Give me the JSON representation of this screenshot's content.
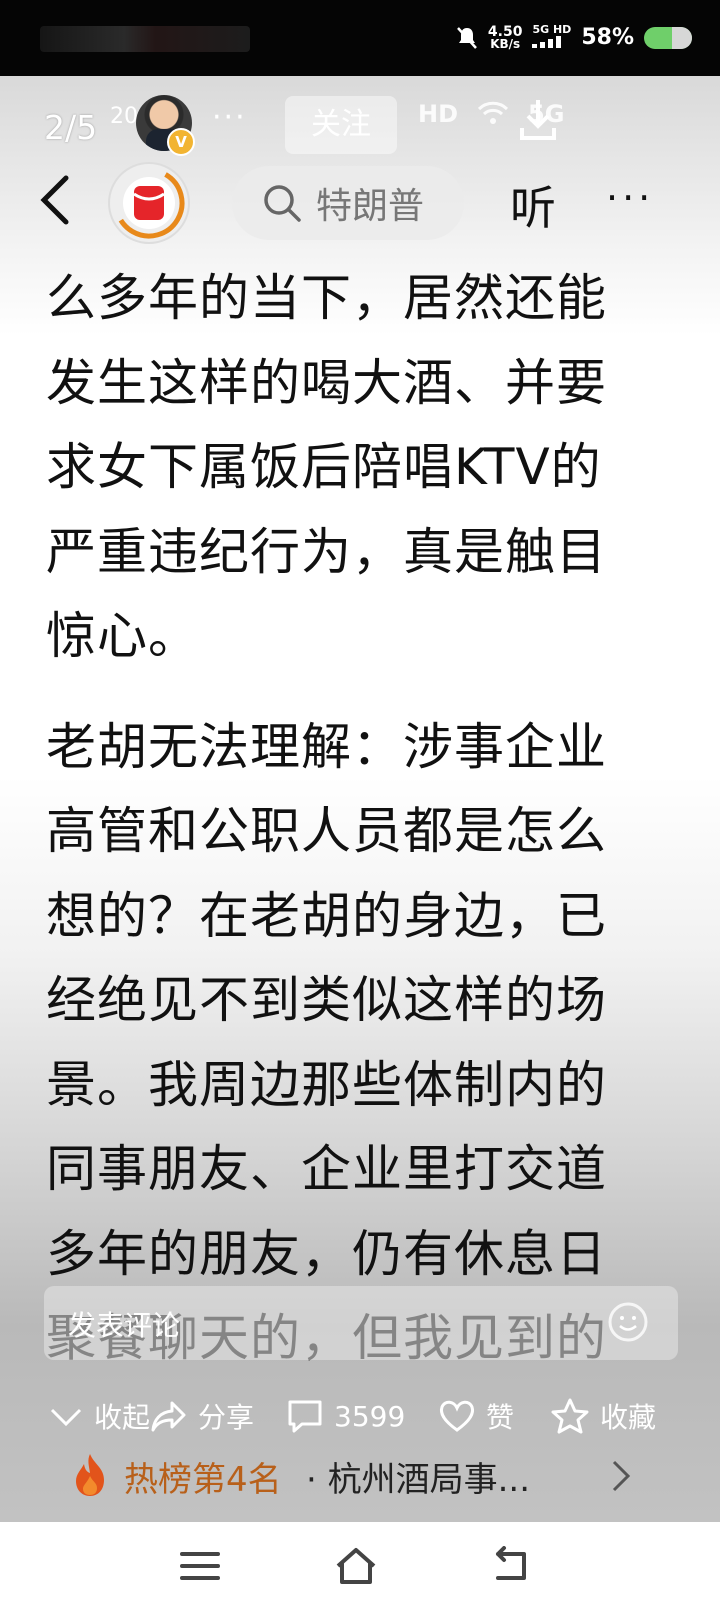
{
  "status_bar": {
    "speed_value": "4.50",
    "speed_unit": "KB/s",
    "network": "5G HD",
    "battery_percent": "58%",
    "battery_level": 0.58
  },
  "top_strip": {
    "page_counter": "2/5",
    "page_counter_sup": "20",
    "author_badge": "V",
    "more": "···",
    "follow_label": "关注",
    "hd_label": "HD",
    "sig_label": "5G"
  },
  "nav": {
    "search_text": "特朗普",
    "listen_label": "听",
    "more": "···"
  },
  "article": {
    "paragraphs": [
      "么多年的当下，居然还能发生这样的喝大酒、并要求女下属饭后陪唱KTV的严重违纪行为，真是触目惊心。",
      "老胡无法理解：涉事企业高管和公职人员都是怎么想的？在老胡的身边，已经绝见不到类似这样的场景。我周边那些体制内的同事朋友、企业里打交道多年的朋友，仍有休息日聚餐聊天的，但我见到的"
    ]
  },
  "comment": {
    "placeholder": "发表评论"
  },
  "actions": {
    "collapse_label": "收起",
    "share_label": "分享",
    "comments_count": "3599",
    "like_label": "赞",
    "favorite_label": "收藏"
  },
  "hot": {
    "rank_label": "热榜第4名",
    "title": "· 杭州酒局事..."
  },
  "colors": {
    "accent_orange": "#e8891a",
    "brand_red": "#e5252a",
    "hot_text": "#b8601a"
  }
}
